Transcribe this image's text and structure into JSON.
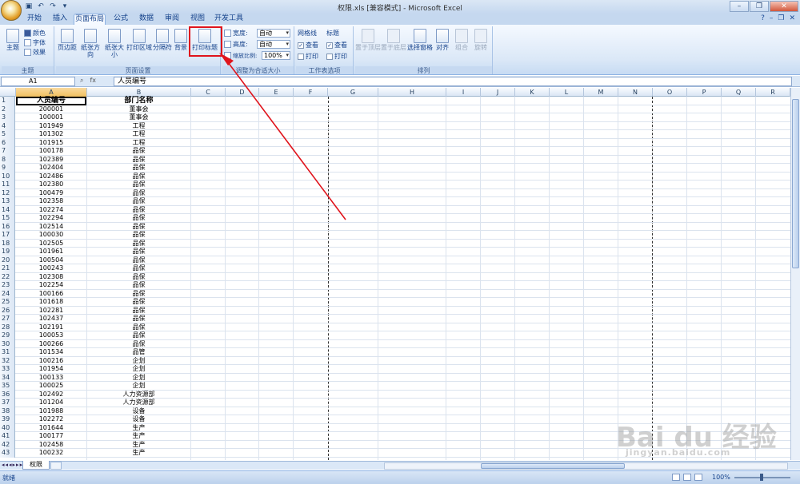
{
  "window": {
    "title": "权限.xls  [兼容模式] - Microsoft Excel"
  },
  "tabs": [
    "开始",
    "插入",
    "页面布局",
    "公式",
    "数据",
    "审阅",
    "视图",
    "开发工具"
  ],
  "active_tab": "页面布局",
  "ribbon": {
    "theme": {
      "themes": "主题",
      "colors": "颜色",
      "fonts": "字体",
      "effects": "效果",
      "group": "主题"
    },
    "page_setup": {
      "margins": "页边距",
      "orientation": "纸张方向",
      "size": "纸张大小",
      "print_area": "打印区域",
      "breaks": "分隔符",
      "background": "背景",
      "print_titles": "打印标题",
      "group": "页面设置"
    },
    "scale": {
      "width_label": "宽度:",
      "width_val": "自动",
      "height_label": "高度:",
      "height_val": "自动",
      "scale_label": "缩放比例:",
      "scale_val": "100%",
      "group": "调整为合适大小"
    },
    "sheet_opts": {
      "gridlines": "网格线",
      "headings": "标题",
      "view": "查看",
      "print": "打印",
      "group": "工作表选项"
    },
    "arrange": {
      "bring_front": "置于顶层",
      "send_back": "置于底层",
      "selection_pane": "选择窗格",
      "align": "对齐",
      "group": "组合",
      "rotate": "旋转",
      "group_label": "排列"
    }
  },
  "formula_bar": {
    "name_box": "A1",
    "fx": "fx",
    "content": "人员编号"
  },
  "columns": [
    "A",
    "B",
    "C",
    "D",
    "E",
    "F",
    "G",
    "H",
    "I",
    "J",
    "K",
    "L",
    "M",
    "N",
    "O",
    "P",
    "Q",
    "R"
  ],
  "header_row": {
    "a": "人员编号",
    "b": "部门名称"
  },
  "rows": [
    [
      "2",
      "200001",
      "董事会"
    ],
    [
      "3",
      "100001",
      "董事会"
    ],
    [
      "4",
      "101949",
      "工程"
    ],
    [
      "5",
      "101302",
      "工程"
    ],
    [
      "6",
      "101915",
      "工程"
    ],
    [
      "7",
      "100178",
      "品保"
    ],
    [
      "8",
      "102389",
      "品保"
    ],
    [
      "9",
      "102404",
      "品保"
    ],
    [
      "10",
      "102486",
      "品保"
    ],
    [
      "11",
      "102380",
      "品保"
    ],
    [
      "12",
      "100479",
      "品保"
    ],
    [
      "13",
      "102358",
      "品保"
    ],
    [
      "14",
      "102274",
      "品保"
    ],
    [
      "15",
      "102294",
      "品保"
    ],
    [
      "16",
      "102514",
      "品保"
    ],
    [
      "17",
      "100030",
      "品保"
    ],
    [
      "18",
      "102505",
      "品保"
    ],
    [
      "19",
      "101961",
      "品保"
    ],
    [
      "20",
      "100504",
      "品保"
    ],
    [
      "21",
      "100243",
      "品保"
    ],
    [
      "22",
      "102308",
      "品保"
    ],
    [
      "23",
      "102254",
      "品保"
    ],
    [
      "24",
      "100166",
      "品保"
    ],
    [
      "25",
      "101618",
      "品保"
    ],
    [
      "26",
      "102281",
      "品保"
    ],
    [
      "27",
      "102437",
      "品保"
    ],
    [
      "28",
      "102191",
      "品保"
    ],
    [
      "29",
      "100053",
      "品保"
    ],
    [
      "30",
      "100266",
      "品保"
    ],
    [
      "31",
      "101534",
      "品管"
    ],
    [
      "32",
      "100216",
      "企划"
    ],
    [
      "33",
      "101954",
      "企划"
    ],
    [
      "34",
      "100133",
      "企划"
    ],
    [
      "35",
      "100025",
      "企划"
    ],
    [
      "36",
      "102492",
      "人力资源部"
    ],
    [
      "37",
      "101204",
      "人力资源部"
    ],
    [
      "38",
      "101988",
      "设备"
    ],
    [
      "39",
      "102272",
      "设备"
    ],
    [
      "40",
      "101644",
      "生产"
    ],
    [
      "41",
      "100177",
      "生产"
    ],
    [
      "42",
      "102458",
      "生产"
    ],
    [
      "43",
      "100232",
      "生产"
    ]
  ],
  "sheet": {
    "tab": "权限"
  },
  "status": {
    "ready": "就绪",
    "zoom": "100%"
  },
  "watermark": {
    "brand": "Bai du 经验",
    "url": "jingyan.baidu.com"
  },
  "annotation_color": "#e0141c"
}
